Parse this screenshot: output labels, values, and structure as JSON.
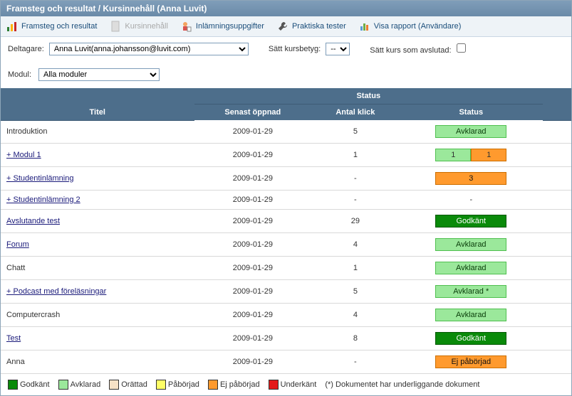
{
  "titlebar": "Framsteg och resultat / Kursinnehåll (Anna Luvit)",
  "toolbar": {
    "progress": "Framsteg och resultat",
    "content": "Kursinnehåll",
    "submissions": "Inlämningsuppgifter",
    "practical": "Praktiska tester",
    "report": "Visa rapport (Användare)"
  },
  "filters": {
    "participant_label": "Deltagare:",
    "participant_value": "Anna Luvit(anna.johansson@luvit.com)",
    "grade_label": "Sätt kursbetyg:",
    "grade_value": "--",
    "complete_label": "Sätt kurs som avslutad:",
    "module_label": "Modul:",
    "module_value": "Alla moduler"
  },
  "headers": {
    "title": "Titel",
    "status_group": "Status",
    "last_opened": "Senast öppnad",
    "clicks": "Antal klick",
    "status": "Status"
  },
  "rows": [
    {
      "title": "Introduktion",
      "link": false,
      "date": "2009-01-29",
      "clicks": "5",
      "status_type": "green-light",
      "status_text": "Avklarad"
    },
    {
      "title": "+ Modul 1",
      "link": true,
      "date": "2009-01-29",
      "clicks": "1",
      "status_type": "split",
      "split_a": "1",
      "split_b": "1"
    },
    {
      "title": "+ Studentinlämning",
      "link": true,
      "date": "2009-01-29",
      "clicks": "-",
      "status_type": "orange",
      "status_text": "3"
    },
    {
      "title": "+ Studentinlämning 2",
      "link": true,
      "date": "2009-01-29",
      "clicks": "-",
      "status_type": "none",
      "status_text": "-"
    },
    {
      "title": "Avslutande test",
      "link": true,
      "date": "2009-01-29",
      "clicks": "29",
      "status_type": "green-dark",
      "status_text": "Godkänt"
    },
    {
      "title": "Forum",
      "link": true,
      "date": "2009-01-29",
      "clicks": "4",
      "status_type": "green-light",
      "status_text": "Avklarad"
    },
    {
      "title": "Chatt",
      "link": false,
      "date": "2009-01-29",
      "clicks": "1",
      "status_type": "green-light",
      "status_text": "Avklarad"
    },
    {
      "title": "+ Podcast med föreläsningar",
      "link": true,
      "date": "2009-01-29",
      "clicks": "5",
      "status_type": "green-light",
      "status_text": "Avklarad *"
    },
    {
      "title": "Computercrash",
      "link": false,
      "date": "2009-01-29",
      "clicks": "4",
      "status_type": "green-light",
      "status_text": "Avklarad"
    },
    {
      "title": "Test",
      "link": true,
      "date": "2009-01-29",
      "clicks": "8",
      "status_type": "green-dark",
      "status_text": "Godkänt"
    },
    {
      "title": "Anna",
      "link": false,
      "date": "2009-01-29",
      "clicks": "-",
      "status_type": "orange",
      "status_text": "Ej påbörjad"
    }
  ],
  "legend": {
    "godkant": "Godkänt",
    "avklarad": "Avklarad",
    "orattad": "Orättad",
    "paborjad": "Påbörjad",
    "ejpab": "Ej påbörjad",
    "underk": "Underkänt",
    "note": "(*)  Dokumentet har underliggande dokument"
  }
}
